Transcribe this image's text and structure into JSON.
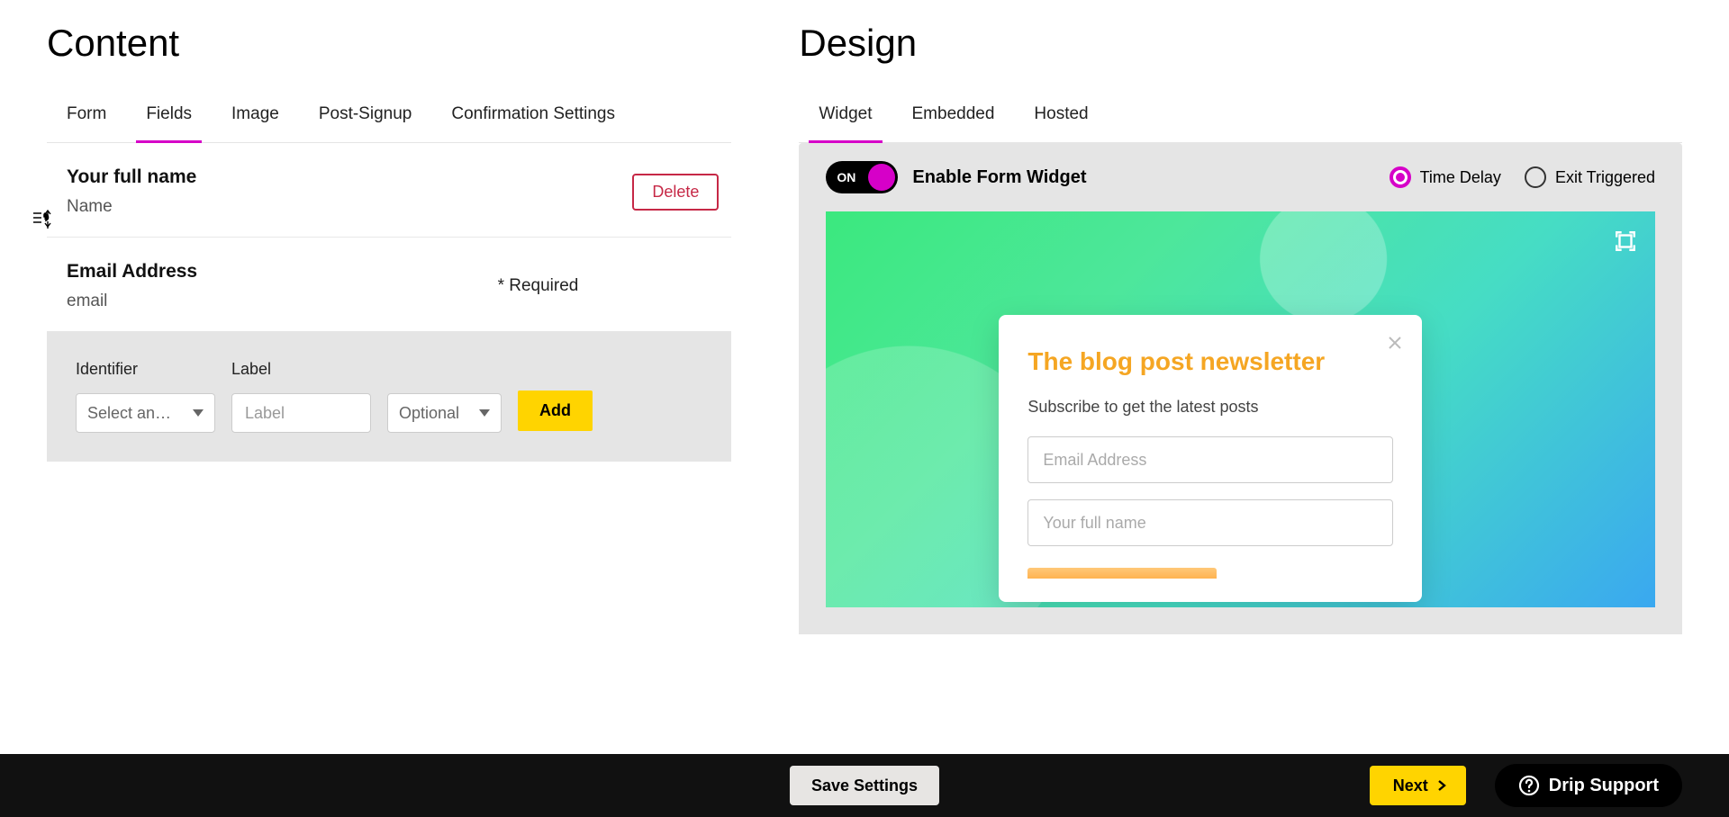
{
  "left": {
    "title": "Content",
    "tabs": [
      "Form",
      "Fields",
      "Image",
      "Post-Signup",
      "Confirmation Settings"
    ],
    "active_tab": 1,
    "fields": [
      {
        "label": "Your full name",
        "identifier": "Name",
        "delete_label": "Delete"
      },
      {
        "label": "Email Address",
        "identifier": "email",
        "required_note": "* Required"
      }
    ],
    "add_field": {
      "identifier_label": "Identifier",
      "identifier_placeholder": "Select an…",
      "label_label": "Label",
      "label_placeholder": "Label",
      "requirement_value": "Optional",
      "add_label": "Add"
    }
  },
  "right": {
    "title": "Design",
    "tabs": [
      "Widget",
      "Embedded",
      "Hosted"
    ],
    "active_tab": 0,
    "toolbar": {
      "toggle_state": "ON",
      "enable_label": "Enable Form Widget",
      "radios": [
        {
          "label": "Time Delay",
          "selected": true
        },
        {
          "label": "Exit Triggered",
          "selected": false
        }
      ]
    },
    "preview": {
      "title": "The blog post newsletter",
      "subtitle": "Subscribe to get the latest posts",
      "email_placeholder": "Email Address",
      "name_placeholder": "Your full name"
    }
  },
  "footer": {
    "save_label": "Save Settings",
    "next_label": "Next",
    "support_label": "Drip Support"
  }
}
